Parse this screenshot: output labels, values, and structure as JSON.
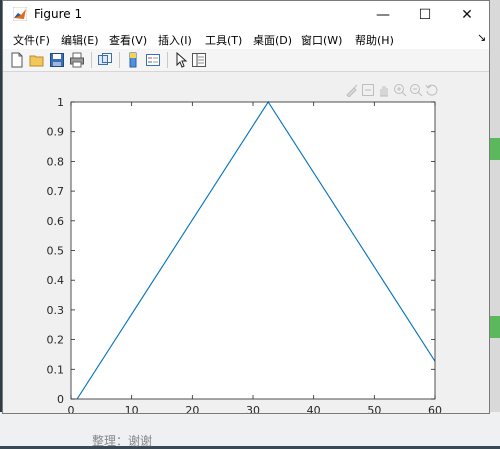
{
  "window": {
    "title": "Figure 1",
    "minimize_glyph": "—",
    "maximize_glyph": "☐",
    "close_glyph": "✕"
  },
  "menu": [
    {
      "label": "文件(F)"
    },
    {
      "label": "编辑(E)"
    },
    {
      "label": "查看(V)"
    },
    {
      "label": "插入(I)"
    },
    {
      "label": "工具(T)"
    },
    {
      "label": "桌面(D)"
    },
    {
      "label": "窗口(W)"
    },
    {
      "label": "帮助(H)"
    }
  ],
  "menu_overflow_glyph": "↘",
  "toolbar_icons": [
    "new-figure-icon",
    "open-file-icon",
    "save-icon",
    "print-icon",
    "link-plot-icon",
    "colorbar-icon",
    "legend-icon",
    "edit-pointer-icon",
    "property-inspector-icon"
  ],
  "axes_toolbar_icons": [
    "brush-icon",
    "data-tips-icon",
    "pan-icon",
    "zoom-in-icon",
    "zoom-out-icon",
    "restore-view-icon"
  ],
  "background": {
    "caption": "整理：谢谢"
  },
  "chart_data": {
    "type": "line",
    "title": "",
    "xlabel": "",
    "ylabel": "",
    "xlim": [
      0,
      60
    ],
    "ylim": [
      0,
      1
    ],
    "xticks": [
      0,
      10,
      20,
      30,
      40,
      50,
      60
    ],
    "yticks": [
      0,
      0.1,
      0.2,
      0.3,
      0.4,
      0.5,
      0.6,
      0.7,
      0.8,
      0.9,
      1
    ],
    "grid": false,
    "series": [
      {
        "color": "#0072bd",
        "x": [
          1,
          32.5,
          64
        ],
        "y": [
          0,
          1,
          0
        ]
      }
    ],
    "colors": {
      "axes_bg": "#ffffff",
      "axis": "#262626",
      "figure_bg": "#f0f0f0"
    }
  }
}
